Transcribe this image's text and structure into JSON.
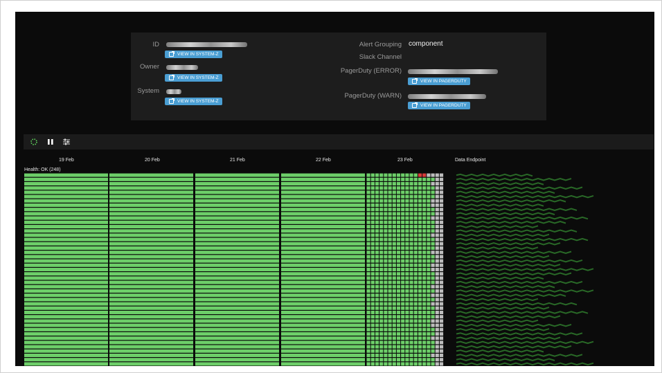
{
  "info": {
    "id_label": "ID",
    "owner_label": "Owner",
    "system_label": "System",
    "view_system_label": "VIEW IN SYSTEM-Z",
    "alert_grouping_label": "Alert Grouping",
    "alert_grouping_value": "component",
    "slack_label": "Slack Channel",
    "pd_error_label": "PagerDuty (ERROR)",
    "pd_warn_label": "PagerDuty (WARN)",
    "view_pagerduty_label": "VIEW IN PAGERDUTY"
  },
  "toolbar": {
    "icons": [
      "refresh-spinner-icon",
      "pause-icon",
      "filter-settings-icon"
    ]
  },
  "timeline": {
    "dates": [
      "19 Feb",
      "20 Feb",
      "21 Feb",
      "22 Feb",
      "23 Feb"
    ],
    "health_label": "Health: OK (248)",
    "endpoint_header": "Data Endpoint",
    "row_count": 45
  },
  "colors": {
    "ok": "#6dcf69",
    "error": "#d83a3a",
    "nodata": "#bdbdbd",
    "background": "#0b0b0b",
    "button": "#4a9ed3"
  }
}
